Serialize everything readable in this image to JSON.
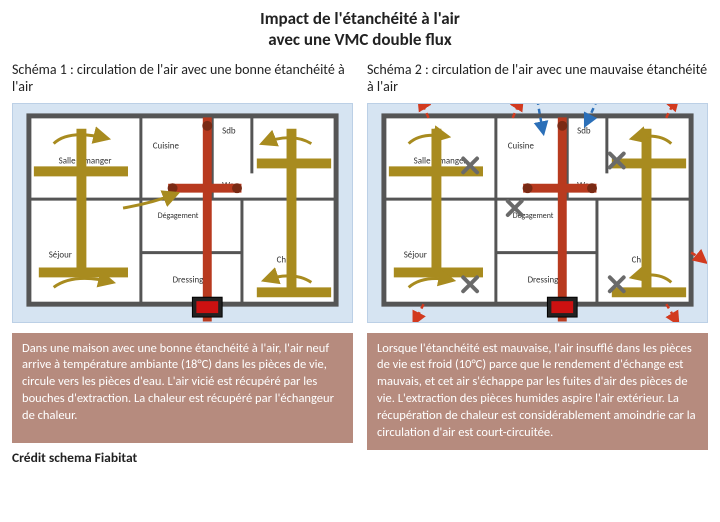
{
  "title_line1": "Impact de l'étanchéité à l'air",
  "title_line2": "avec une VMC double flux",
  "col1": {
    "subtitle": "Schéma 1 : circulation de l'air avec une bonne étanchéité à l'air",
    "caption": "Dans une maison avec une bonne étanchéité à l'air, l'air neuf arrive à température ambiante (18°C) dans les pièces de vie, circule vers les pièces d'eau. L'air vicié est récupéré par les bouches d'extraction. La chaleur est récupéré par l'échangeur de chaleur.",
    "rooms": {
      "salle_a_manger": "Salle à manger",
      "cuisine": "Cuisine",
      "sdb": "Sdb",
      "wc": "Wc",
      "degagement": "Dégagement",
      "sejour": "Séjour",
      "dressing": "Dressing",
      "ch1": "Ch 1"
    }
  },
  "col2": {
    "subtitle": "Schéma 2 : circulation de l'air avec une mauvaise étanchéité à l'air",
    "caption": "Lorsque l'étanchéité est mauvaise, l'air insufflé dans les pièces de vie est froid (10°C) parce que le rendement d'échange est mauvais, et cet air s'échappe par les fuites d'air des pièces de vie. L'extraction des pièces humides aspire l'air extérieur. La récupération de chaleur est considérablement amoindrie car la circulation d'air est court-circuitée.",
    "rooms": {
      "salle_a_manger": "Salle à manger",
      "cuisine": "Cuisine",
      "sdb": "Sdb",
      "wc": "Wc",
      "degagement": "Dégagement",
      "sejour": "Séjour",
      "dressing": "Dressing",
      "ch1": "Ch 1"
    }
  },
  "credit": "Crédit schema Fiabitat",
  "colors": {
    "wall": "#555",
    "supply": "#a88b1f",
    "extract": "#b83a1f",
    "leak_hot": "#d23a1f",
    "leak_cold": "#2b6fb8",
    "block": "#6a6a6a",
    "heater": "#c11"
  }
}
